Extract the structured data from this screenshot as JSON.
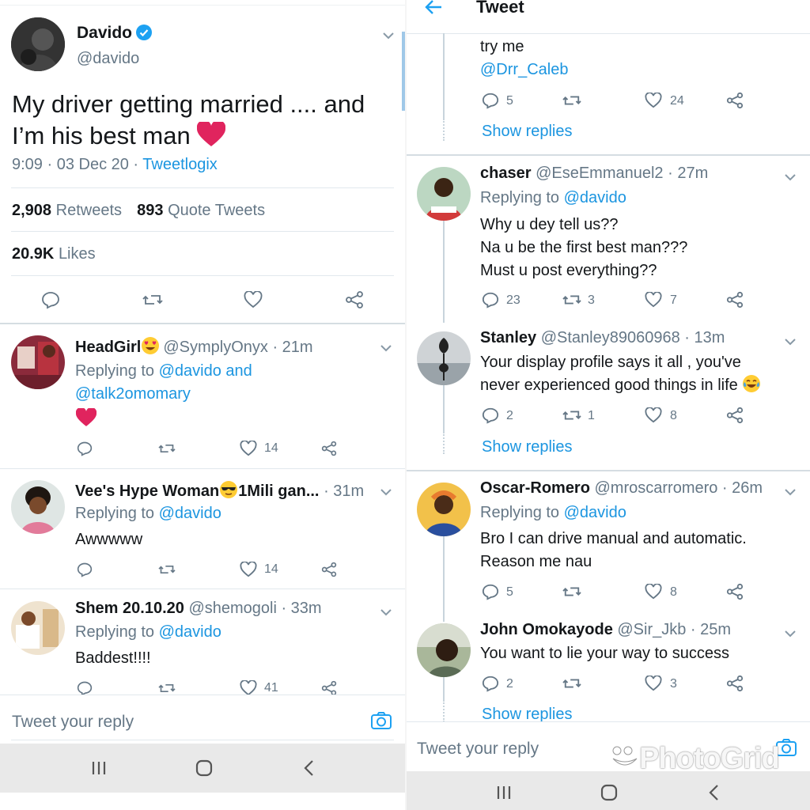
{
  "left": {
    "main": {
      "name": "Davido",
      "handle": "@davido",
      "text_line1": "My driver getting married .... and",
      "text_line2": "I’m his best man",
      "time_date": "9:09 · 03 Dec 20 · ",
      "source": "Tweetlogix",
      "retweets_count": "2,908",
      "retweets_label": "Retweets",
      "quotes_count": "893",
      "quotes_label": "Quote Tweets",
      "likes_count": "20.9K",
      "likes_label": "Likes"
    },
    "replies": [
      {
        "name": "HeadGirl",
        "handle": "@SymplyOnyx · 21m",
        "reply_prefix": "Replying to ",
        "reply_to": "@davido and",
        "reply_to2": "@talk2omomary",
        "likes": "14"
      },
      {
        "name": "Vee's Hype Woman",
        "name2": "1Mili gan...",
        "handle": "· 31m",
        "reply_prefix": "Replying to ",
        "reply_to": "@davido",
        "text": "Awwwww",
        "likes": "14"
      },
      {
        "name": "Shem 20.10.20",
        "handle": "@shemogoli · 33m",
        "reply_prefix": "Replying to ",
        "reply_to": "@davido",
        "text": "Baddest!!!!",
        "likes": "41"
      }
    ],
    "reply_placeholder": "Tweet your reply"
  },
  "right": {
    "header_title": "Tweet",
    "top": {
      "text": "try me",
      "mention": "@Drr_Caleb",
      "replies": "5",
      "likes": "24",
      "show_replies": "Show replies"
    },
    "replies": [
      {
        "name": "chaser",
        "handle": "@EseEmmanuel2 · 27m",
        "reply_prefix": "Replying to ",
        "reply_to": "@davido",
        "lines": [
          "Why u dey tell us??",
          "Na u be the first best man???",
          "Must u post everything??"
        ],
        "replies": "23",
        "retweets": "3",
        "likes": "7"
      },
      {
        "name": "Stanley",
        "handle": "@Stanley89060968 · 13m",
        "lines": [
          "Your display profile says it all , you've",
          "never experienced good things in life"
        ],
        "replies": "2",
        "retweets": "1",
        "likes": "8",
        "show_replies": "Show replies"
      },
      {
        "name": "Oscar-Romero",
        "handle": "@mroscarromero · 26m",
        "reply_prefix": "Replying to ",
        "reply_to": "@davido",
        "lines": [
          "Bro I can drive manual and automatic.",
          "Reason me nau"
        ],
        "replies": "5",
        "likes": "8"
      },
      {
        "name": "John Omokayode",
        "handle": "@Sir_Jkb · 25m",
        "lines": [
          "You want to lie your way to success"
        ],
        "replies": "2",
        "likes": "3",
        "show_replies": "Show replies"
      }
    ],
    "reply_placeholder": "Tweet your reply",
    "watermark": "PhotoGrid"
  },
  "colors": {
    "accent": "#1b95e0",
    "gray": "#657786",
    "divider": "#e1e8ed",
    "heart": "#e0245e"
  }
}
